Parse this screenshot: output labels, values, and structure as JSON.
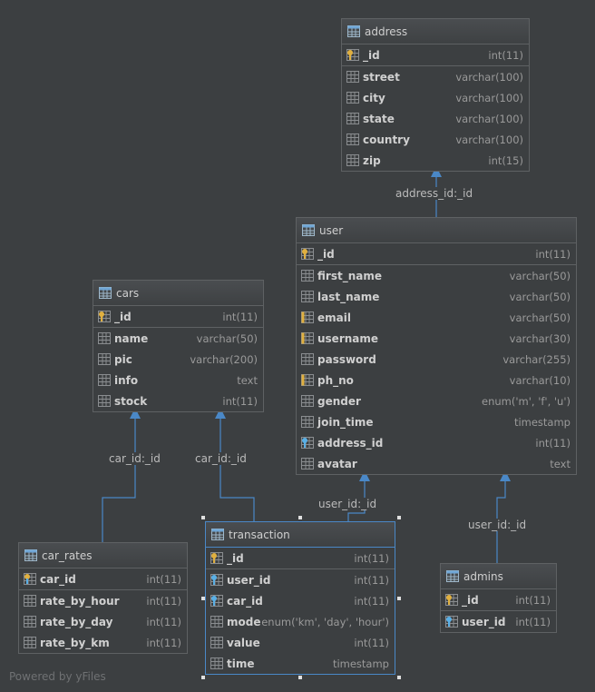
{
  "tables": [
    {
      "key": "address",
      "name": "address",
      "columns": [
        {
          "name": "_id",
          "type": "int(11)",
          "kind": "pk"
        },
        {
          "name": "street",
          "type": "varchar(100)",
          "kind": "col"
        },
        {
          "name": "city",
          "type": "varchar(100)",
          "kind": "col"
        },
        {
          "name": "state",
          "type": "varchar(100)",
          "kind": "col"
        },
        {
          "name": "country",
          "type": "varchar(100)",
          "kind": "col"
        },
        {
          "name": "zip",
          "type": "int(15)",
          "kind": "col"
        }
      ]
    },
    {
      "key": "user",
      "name": "user",
      "columns": [
        {
          "name": "_id",
          "type": "int(11)",
          "kind": "pk"
        },
        {
          "name": "first_name",
          "type": "varchar(50)",
          "kind": "col"
        },
        {
          "name": "last_name",
          "type": "varchar(50)",
          "kind": "col"
        },
        {
          "name": "email",
          "type": "varchar(50)",
          "kind": "unique"
        },
        {
          "name": "username",
          "type": "varchar(30)",
          "kind": "unique"
        },
        {
          "name": "password",
          "type": "varchar(255)",
          "kind": "col"
        },
        {
          "name": "ph_no",
          "type": "varchar(10)",
          "kind": "unique"
        },
        {
          "name": "gender",
          "type": "enum('m', 'f', 'u')",
          "kind": "col"
        },
        {
          "name": "join_time",
          "type": "timestamp",
          "kind": "col"
        },
        {
          "name": "address_id",
          "type": "int(11)",
          "kind": "fk"
        },
        {
          "name": "avatar",
          "type": "text",
          "kind": "col"
        }
      ]
    },
    {
      "key": "cars",
      "name": "cars",
      "columns": [
        {
          "name": "_id",
          "type": "int(11)",
          "kind": "pk"
        },
        {
          "name": "name",
          "type": "varchar(50)",
          "kind": "col"
        },
        {
          "name": "pic",
          "type": "varchar(200)",
          "kind": "col"
        },
        {
          "name": "info",
          "type": "text",
          "kind": "col"
        },
        {
          "name": "stock",
          "type": "int(11)",
          "kind": "col"
        }
      ]
    },
    {
      "key": "car_rates",
      "name": "car_rates",
      "columns": [
        {
          "name": "car_id",
          "type": "int(11)",
          "kind": "pkfk"
        },
        {
          "name": "rate_by_hour",
          "type": "int(11)",
          "kind": "col"
        },
        {
          "name": "rate_by_day",
          "type": "int(11)",
          "kind": "col"
        },
        {
          "name": "rate_by_km",
          "type": "int(11)",
          "kind": "col"
        }
      ]
    },
    {
      "key": "transaction",
      "name": "transaction",
      "columns": [
        {
          "name": "_id",
          "type": "int(11)",
          "kind": "pk"
        },
        {
          "name": "user_id",
          "type": "int(11)",
          "kind": "fk"
        },
        {
          "name": "car_id",
          "type": "int(11)",
          "kind": "fk"
        },
        {
          "name": "mode",
          "type": "enum('km', 'day', 'hour')",
          "kind": "col"
        },
        {
          "name": "value",
          "type": "int(11)",
          "kind": "col"
        },
        {
          "name": "time",
          "type": "timestamp",
          "kind": "col"
        }
      ]
    },
    {
      "key": "admins",
      "name": "admins",
      "columns": [
        {
          "name": "_id",
          "type": "int(11)",
          "kind": "pk"
        },
        {
          "name": "user_id",
          "type": "int(11)",
          "kind": "fk"
        }
      ]
    }
  ],
  "relations": [
    {
      "key": "user-address",
      "label": "address_id:_id"
    },
    {
      "key": "rates-cars",
      "label": "car_id:_id"
    },
    {
      "key": "trans-cars",
      "label": "car_id:_id"
    },
    {
      "key": "trans-user",
      "label": "user_id:_id"
    },
    {
      "key": "admins-user",
      "label": "user_id:_id"
    }
  ],
  "watermark": "Powered by yFiles",
  "colors": {
    "background": "#3c3f41",
    "edge": "#4a88c7",
    "border": "#5e6163",
    "key": "#e0b040"
  }
}
